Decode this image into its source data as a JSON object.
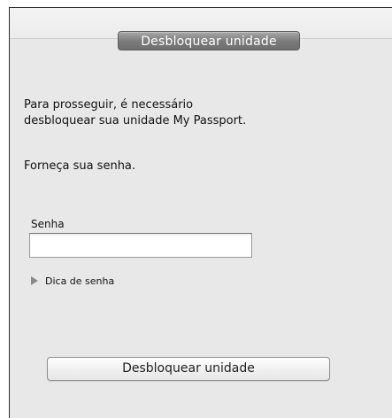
{
  "dialog": {
    "title": "Desbloquear unidade",
    "message_line1": "Para prosseguir, é necessário",
    "message_line2": "desbloquear sua unidade My Passport.",
    "prompt": "Forneça sua senha."
  },
  "password": {
    "label": "Senha",
    "value": "",
    "placeholder": ""
  },
  "hint": {
    "label": "Dica de senha",
    "icon": "disclosure-triangle-right-icon",
    "expanded": false
  },
  "actions": {
    "unlock_label": "Desbloquear unidade"
  }
}
